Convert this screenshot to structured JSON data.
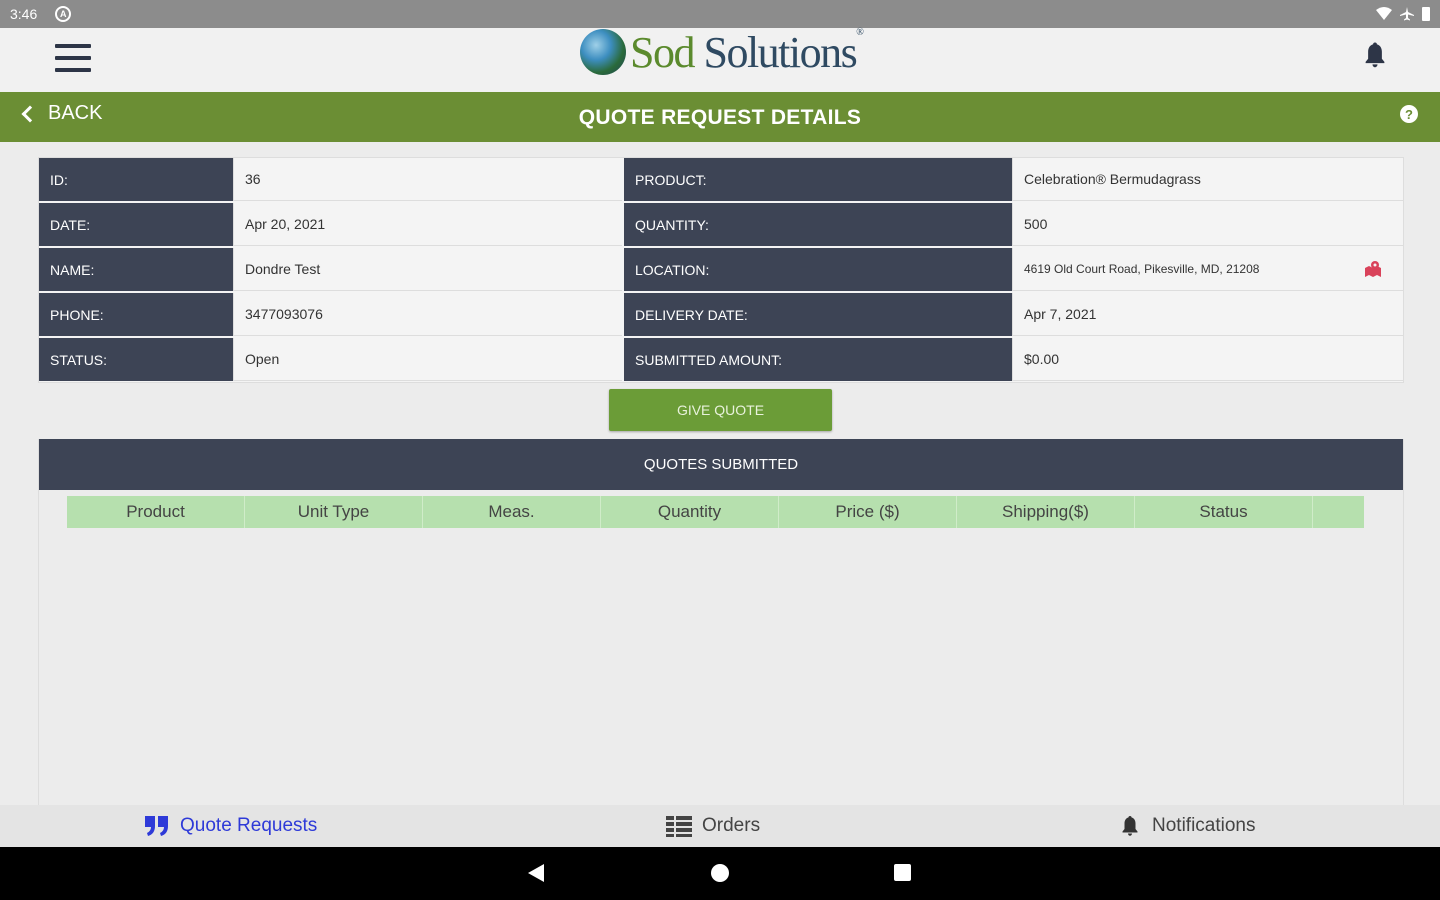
{
  "status_bar": {
    "time": "3:46",
    "icon": "A"
  },
  "header": {
    "logo_sod": "Sod",
    "logo_solutions": "Solutions",
    "logo_mark": "®"
  },
  "nav_bar": {
    "back_label": "BACK",
    "title": "QUOTE REQUEST DETAILS",
    "help": "?"
  },
  "details": {
    "left": [
      {
        "label": "ID:",
        "value": "36"
      },
      {
        "label": "DATE:",
        "value": "Apr 20, 2021"
      },
      {
        "label": "NAME:",
        "value": "Dondre Test"
      },
      {
        "label": "PHONE:",
        "value": "3477093076"
      },
      {
        "label": "STATUS:",
        "value": "Open"
      }
    ],
    "right": [
      {
        "label": "PRODUCT:",
        "value": "Celebration® Bermudagrass"
      },
      {
        "label": "QUANTITY:",
        "value": "500"
      },
      {
        "label": "LOCATION:",
        "value": "4619 Old Court Road, Pikesville, MD, 21208"
      },
      {
        "label": "DELIVERY DATE:",
        "value": "Apr 7, 2021"
      },
      {
        "label": "SUBMITTED AMOUNT:",
        "value": "$0.00"
      }
    ]
  },
  "give_quote_label": "GIVE QUOTE",
  "quotes": {
    "title": "QUOTES SUBMITTED",
    "columns": [
      "Product",
      "Unit Type",
      "Meas.",
      "Quantity",
      "Price ($)",
      "Shipping($)",
      "Status"
    ]
  },
  "bottom_nav": {
    "quote_requests": "Quote Requests",
    "orders": "Orders",
    "notifications": "Notifications"
  },
  "colors": {
    "brand_green": "#6b8e34",
    "label_navy": "#3d4455",
    "table_header_green": "#b6e0ae",
    "active_nav_blue": "#2e3ad8",
    "map_pin_red": "#d9425a"
  }
}
